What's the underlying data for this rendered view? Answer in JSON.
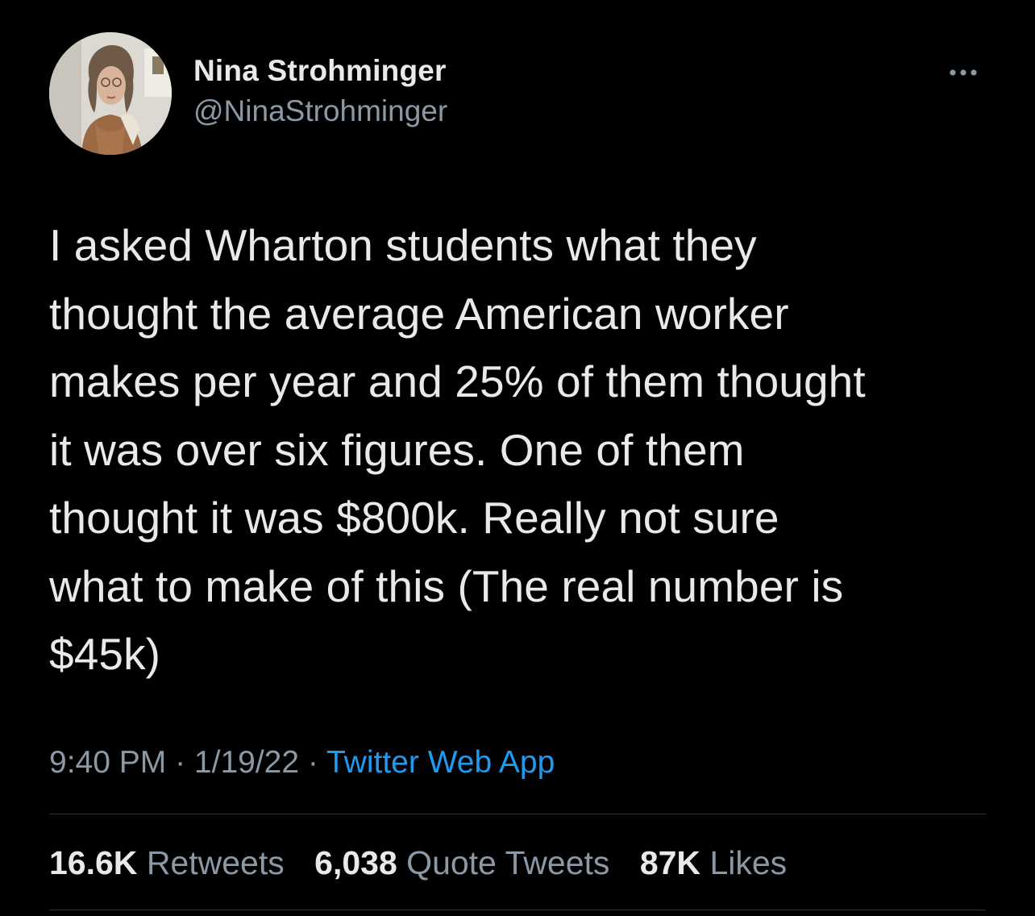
{
  "author": {
    "display_name": "Nina Strohminger",
    "handle": "@NinaStrohminger"
  },
  "tweet": {
    "text": "I asked Wharton students what they\nthought the average American worker\nmakes per year and 25% of them thought\nit was over six figures. One of them\nthought it was $800k. Really not sure\nwhat to make of this (The real number is\n$45k)"
  },
  "meta": {
    "time": "9:40 PM",
    "separator": " · ",
    "date": "1/19/22",
    "source": "Twitter Web App"
  },
  "stats": {
    "retweets": {
      "count": "16.6K",
      "label": "Retweets"
    },
    "quote_tweets": {
      "count": "6,038",
      "label": "Quote Tweets"
    },
    "likes": {
      "count": "87K",
      "label": "Likes"
    }
  },
  "icons": {
    "more": "more-horizontal-icon"
  },
  "colors": {
    "background": "#000000",
    "primary_text": "#e7e9ea",
    "secondary_text": "#8b98a5",
    "link": "#1d9bf0",
    "divider": "#2f3336"
  }
}
